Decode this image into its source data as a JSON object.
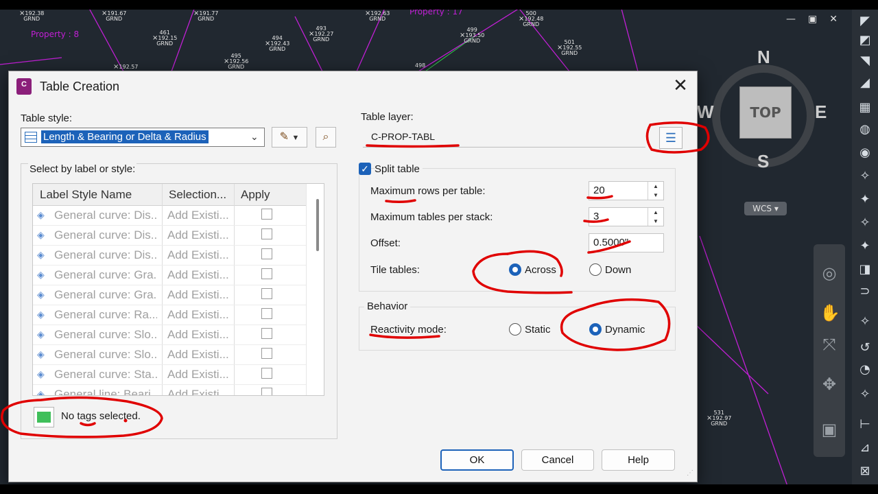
{
  "cad": {
    "points": [
      {
        "id": "",
        "elev": "192.38",
        "code": "GRND"
      },
      {
        "id": "",
        "elev": "192.57",
        "code": "GRND"
      },
      {
        "id": "",
        "elev": "191.77",
        "code": "GRND"
      },
      {
        "id": "461",
        "elev": "192.15",
        "code": "GRND"
      },
      {
        "id": "494",
        "elev": "192.43",
        "code": "GRND"
      },
      {
        "id": "493",
        "elev": "192.27",
        "code": "GRND"
      },
      {
        "id": "495",
        "elev": "192.56",
        "code": "GRND"
      },
      {
        "id": "",
        "elev": "192.57",
        "code": "GRND"
      },
      {
        "id": "",
        "elev": "192.63",
        "code": "GRND"
      },
      {
        "id": "498",
        "elev": "",
        "code": ""
      },
      {
        "id": "499",
        "elev": "193.50",
        "code": "GRND"
      },
      {
        "id": "500",
        "elev": "192.48",
        "code": "GRND"
      },
      {
        "id": "501",
        "elev": "192.55",
        "code": "GRND"
      },
      {
        "id": "531",
        "elev": "192.97",
        "code": "GRND"
      }
    ],
    "property_labels": [
      "Property : 8",
      "Property : 17"
    ],
    "compass": {
      "n": "N",
      "s": "S",
      "e": "E",
      "w": "W",
      "face": "TOP"
    },
    "wcs_label": "WCS ▾"
  },
  "dialog": {
    "title": "Table Creation",
    "app_icon": "C",
    "table_style_label": "Table style:",
    "table_style_value": "Length & Bearing or Delta & Radius",
    "select_group_label": "Select by label or style:",
    "columns": [
      "Label Style Name",
      "Selection...",
      "Apply"
    ],
    "rows": [
      {
        "name": "General curve: Dis...",
        "sel": "Add Existi..."
      },
      {
        "name": "General curve: Dis...",
        "sel": "Add Existi..."
      },
      {
        "name": "General curve: Dis...",
        "sel": "Add Existi..."
      },
      {
        "name": "General curve: Gra...",
        "sel": "Add Existi..."
      },
      {
        "name": "General curve: Gra...",
        "sel": "Add Existi..."
      },
      {
        "name": "General curve: Ra...",
        "sel": "Add Existi..."
      },
      {
        "name": "General curve: Slo...",
        "sel": "Add Existi..."
      },
      {
        "name": "General curve: Slo...",
        "sel": "Add Existi..."
      },
      {
        "name": "General curve: Sta...",
        "sel": "Add Existi..."
      },
      {
        "name": "General line: Beari...",
        "sel": "Add Existi..."
      }
    ],
    "tags_status": "No tags selected.",
    "table_layer_label": "Table layer:",
    "table_layer_value": "C-PROP-TABL",
    "split_table_label": "Split table",
    "max_rows_label": "Maximum rows per table:",
    "max_rows_value": "20",
    "max_tables_label": "Maximum tables per stack:",
    "max_tables_value": "3",
    "offset_label": "Offset:",
    "offset_value": "0.5000\"",
    "tile_label": "Tile tables:",
    "tile_across": "Across",
    "tile_down": "Down",
    "tile_selected": "Across",
    "behavior_label": "Behavior",
    "reactivity_label": "Reactivity mode:",
    "static_label": "Static",
    "dynamic_label": "Dynamic",
    "reactivity_selected": "Dynamic",
    "ok": "OK",
    "cancel": "Cancel",
    "help": "Help"
  },
  "colors": {
    "accent": "#1c62b9",
    "annotation": "#e00000",
    "cad_bg": "#212830",
    "property_line": "#c21fd6"
  }
}
